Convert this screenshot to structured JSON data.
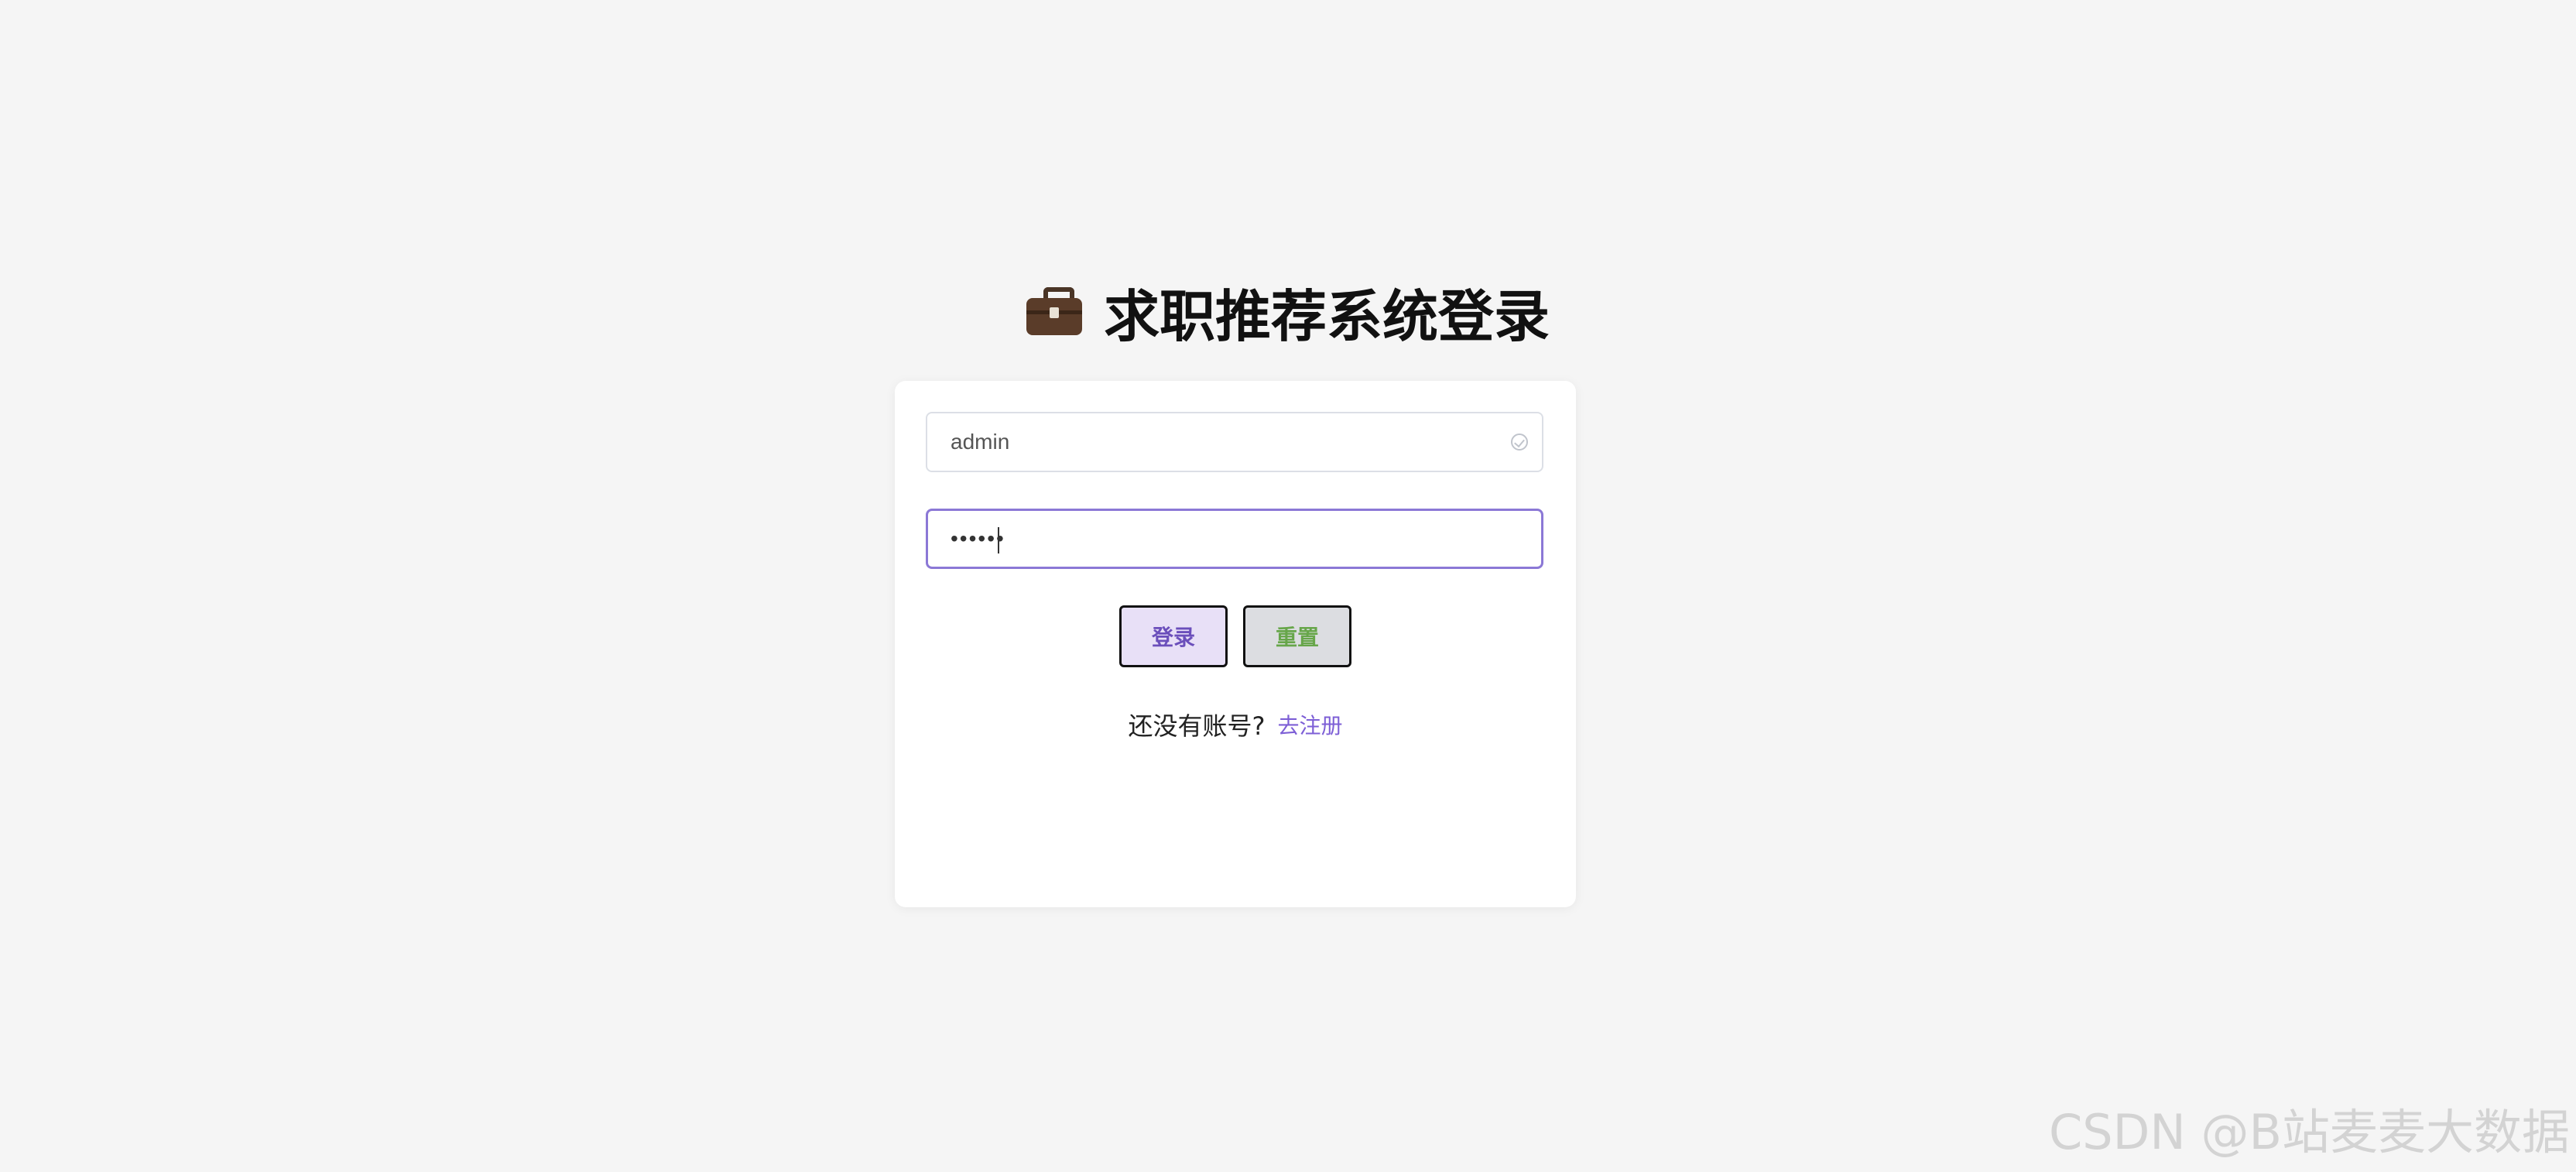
{
  "page": {
    "title_icon": "briefcase-icon",
    "title": "求职推荐系统登录"
  },
  "form": {
    "username_value": "admin",
    "username_status_icon": "check-circle-icon",
    "password_value": "••••••",
    "login_label": "登录",
    "reset_label": "重置",
    "register_prompt": "还没有账号?",
    "register_link": "去注册"
  },
  "watermark": {
    "text": "CSDN @B站麦麦大数据"
  },
  "colors": {
    "background": "#f5f5f5",
    "card": "#ffffff",
    "accent": "#7d5fd6",
    "focus_border": "#8b78d6",
    "login_bg": "#e8e0f7",
    "reset_bg": "#dcdde1",
    "reset_text": "#67a64a"
  }
}
